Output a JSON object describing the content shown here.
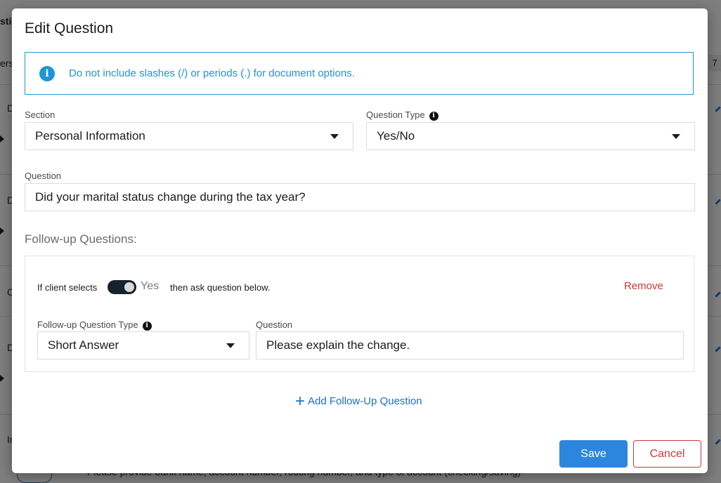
{
  "background": {
    "header_fragment": "stic",
    "subheader_fragment": "ers",
    "badge": "7",
    "row_letters": [
      "D",
      "D",
      "C",
      "D",
      "In"
    ],
    "bottom_text": "Please provide bank name, account number, routing number, and type of account (checking/saving)"
  },
  "modal": {
    "title": "Edit Question",
    "info_message": "Do not include slashes (/) or periods (.) for document options.",
    "section": {
      "label": "Section",
      "value": "Personal Information"
    },
    "question_type": {
      "label": "Question Type",
      "value": "Yes/No"
    },
    "question": {
      "label": "Question",
      "value": "Did your marital status change during the tax year?"
    },
    "followups_heading": "Follow-up Questions:",
    "followup": {
      "if_client_selects": "If client selects",
      "toggle_value": "Yes",
      "toggle_on": true,
      "then_text": "then ask question below.",
      "remove_label": "Remove",
      "type_label": "Follow-up Question Type",
      "type_value": "Short Answer",
      "question_label": "Question",
      "question_value": "Please explain the change."
    },
    "add_followup_label": "Add Follow-Up Question",
    "save_label": "Save",
    "cancel_label": "Cancel"
  },
  "colors": {
    "accent": "#2d86de",
    "info": "#1f95d6",
    "danger": "#d0373a",
    "toggle": "#14232f"
  }
}
